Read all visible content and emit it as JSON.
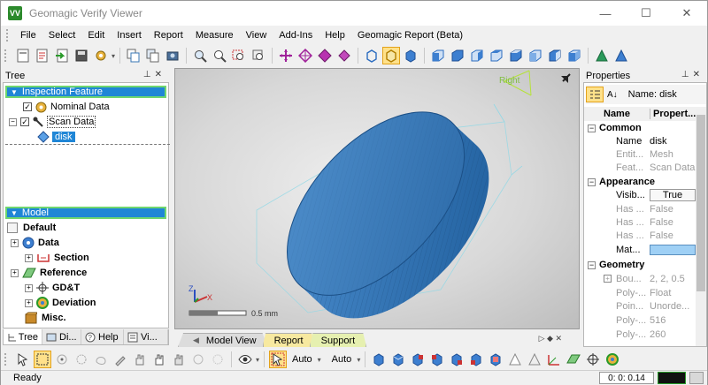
{
  "window": {
    "title": "Geomagic Verify Viewer",
    "logo_text": "VV",
    "controls": {
      "minimize": "—",
      "maximize": "☐",
      "close": "✕"
    }
  },
  "menu": [
    "File",
    "Select",
    "Edit",
    "Insert",
    "Report",
    "Measure",
    "View",
    "Add-Ins",
    "Help",
    "Geomagic Report (Beta)"
  ],
  "tree_panel": {
    "title": "Tree",
    "inspection_header": "Inspection Feature",
    "inspection_items": [
      "Nominal Data",
      "Scan Data",
      "disk"
    ],
    "model_header": "Model",
    "model_items": [
      "Default",
      "Data",
      "Section",
      "Reference",
      "GD&T",
      "Deviation",
      "Misc."
    ]
  },
  "panel_tabs": [
    "Tree",
    "Di...",
    "Help",
    "Vi..."
  ],
  "viewport": {
    "view_label": "Right",
    "scale_label": "0.5 mm",
    "axis_labels": {
      "x": "X",
      "z": "Z"
    }
  },
  "view_tabs": [
    "Model View",
    "Report",
    "Support"
  ],
  "properties": {
    "title": "Properties",
    "selection_label": "Name: disk",
    "col_name": "Name",
    "col_property": "Propert...",
    "categories": {
      "common": "Common",
      "appearance": "Appearance",
      "geometry": "Geometry"
    },
    "common_rows": [
      {
        "key": "Name",
        "value": "disk"
      },
      {
        "key": "Entit...",
        "value": "Mesh"
      },
      {
        "key": "Feat...",
        "value": "Scan Data"
      }
    ],
    "appearance_rows": [
      {
        "key": "Visib...",
        "value": "True"
      },
      {
        "key": "Has ...",
        "value": "False"
      },
      {
        "key": "Has ...",
        "value": "False"
      },
      {
        "key": "Has ...",
        "value": "False"
      },
      {
        "key": "Mat...",
        "value": ""
      }
    ],
    "geometry_rows": [
      {
        "key": "Bou...",
        "value": "2, 2, 0.5"
      },
      {
        "key": "Poly-...",
        "value": "Float"
      },
      {
        "key": "Poin...",
        "value": "Unorde..."
      },
      {
        "key": "Poly-...",
        "value": "516"
      },
      {
        "key": "Poly-...",
        "value": "260"
      }
    ]
  },
  "bottom_toolbar": {
    "dropdown_1": "Auto",
    "dropdown_2": "Auto"
  },
  "status": {
    "left": "Ready",
    "coords": "0: 0: 0.14"
  },
  "colors": {
    "accent": "#1f86d6",
    "disk": "#3a77b6",
    "material_swatch": "#9fd0f5"
  }
}
